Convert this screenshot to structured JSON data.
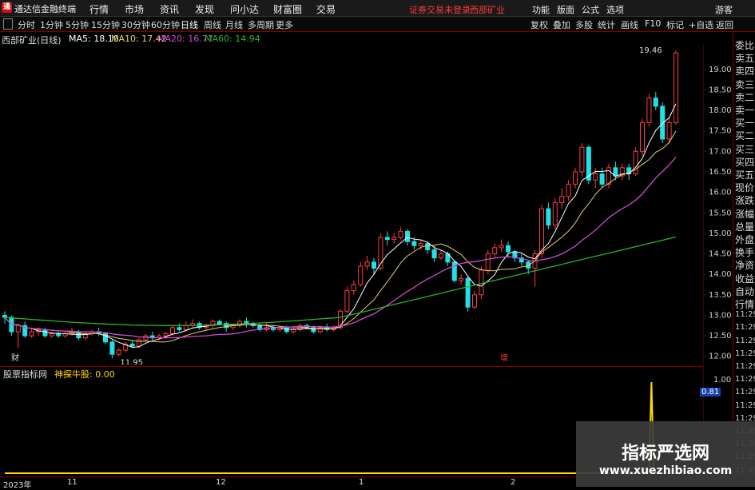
{
  "app": {
    "logo": "通",
    "title": "通达信金融终端"
  },
  "menu": [
    "行情",
    "市场",
    "资讯",
    "发现",
    "问小达",
    "财富圈",
    "交易"
  ],
  "login_status": "证券交易未登录",
  "stock_name_top": "西部矿业",
  "right_menu": [
    "功能",
    "版面",
    "公式",
    "选项",
    "游客"
  ],
  "periods": [
    "分时",
    "1分钟",
    "5分钟",
    "15分钟",
    "30分钟",
    "60分钟",
    "日线",
    "周线",
    "月线",
    "多周期",
    "更多"
  ],
  "active_period": "日线",
  "tools": [
    "复权",
    "叠加",
    "多股",
    "统计",
    "画线",
    "F10",
    "标记",
    "+自选",
    "返回"
  ],
  "ma": {
    "stock": "西部矿业(日线)",
    "ma5": "MA5: 18.10",
    "ma10": "MA10: 17.42",
    "ma20": "MA20: 16.77",
    "ma60": "MA60: 14.94"
  },
  "colors": {
    "up": "#ff3b3b",
    "down": "#21e0e6",
    "ma5": "#ffffff",
    "ma10": "#e6d06a",
    "ma20": "#d04bd0",
    "ma60": "#2ab42a"
  },
  "price_axis": [
    "19.00",
    "18.50",
    "18.00",
    "17.50",
    "17.00",
    "16.50",
    "16.00",
    "15.50",
    "15.00",
    "14.50",
    "14.00",
    "13.50",
    "13.00",
    "12.50",
    "12.00"
  ],
  "annotations": {
    "high": "19.46",
    "low": "11.95",
    "marker1": "财",
    "marker2": "增"
  },
  "indicator": {
    "name": "股票指标网",
    "formula": "神探牛股: 0.00",
    "axis_top": "1.00",
    "axis_mid": "0.81"
  },
  "right_panel": [
    "委比",
    "卖五",
    "卖四",
    "卖三",
    "卖二",
    "卖一",
    "买一",
    "买二",
    "买三",
    "买四",
    "买五",
    "现价",
    "涨跌",
    "涨幅",
    "总量",
    "外盘",
    "换手",
    "净资",
    "收益",
    "自动",
    "行情",
    "11:29",
    "11:29",
    "11:29",
    "11:29",
    "11:29",
    "11:29",
    "11:29",
    "11:29",
    "11:29",
    "11:29",
    "11:29",
    "11:29",
    "11:29"
  ],
  "dates": [
    "2023年",
    "11",
    "12",
    "1",
    "2"
  ],
  "watermark": {
    "title": "指标严选网",
    "url": "www.xuezhibiao.com"
  },
  "chart_data": {
    "type": "candlestick",
    "price_range": [
      11.8,
      19.6
    ],
    "candles": [
      [
        13.0,
        12.95,
        13.1,
        12.8
      ],
      [
        12.95,
        12.6,
        13.0,
        12.5
      ],
      [
        12.6,
        12.75,
        12.8,
        12.2
      ],
      [
        12.75,
        12.5,
        12.85,
        12.45
      ],
      [
        12.5,
        12.6,
        12.7,
        12.45
      ],
      [
        12.6,
        12.65,
        12.7,
        12.5
      ],
      [
        12.65,
        12.5,
        12.7,
        12.45
      ],
      [
        12.5,
        12.55,
        12.6,
        12.45
      ],
      [
        12.55,
        12.5,
        12.6,
        12.45
      ],
      [
        12.5,
        12.55,
        12.6,
        12.45
      ],
      [
        12.55,
        12.6,
        12.7,
        12.5
      ],
      [
        12.6,
        12.45,
        12.65,
        12.4
      ],
      [
        12.45,
        12.55,
        12.6,
        12.4
      ],
      [
        12.55,
        12.6,
        12.65,
        12.5
      ],
      [
        12.6,
        12.55,
        12.7,
        12.5
      ],
      [
        12.55,
        12.35,
        12.6,
        12.3
      ],
      [
        12.35,
        12.05,
        12.4,
        11.95
      ],
      [
        12.05,
        12.15,
        12.2,
        12.0
      ],
      [
        12.15,
        12.3,
        12.35,
        12.1
      ],
      [
        12.3,
        12.25,
        12.4,
        12.2
      ],
      [
        12.25,
        12.4,
        12.45,
        12.2
      ],
      [
        12.4,
        12.5,
        12.55,
        12.35
      ],
      [
        12.5,
        12.45,
        12.6,
        12.4
      ],
      [
        12.45,
        12.5,
        12.55,
        12.4
      ],
      [
        12.5,
        12.55,
        12.6,
        12.45
      ],
      [
        12.55,
        12.7,
        12.75,
        12.5
      ],
      [
        12.7,
        12.65,
        12.8,
        12.6
      ],
      [
        12.65,
        12.75,
        12.85,
        12.6
      ],
      [
        12.75,
        12.8,
        12.9,
        12.7
      ],
      [
        12.8,
        12.7,
        12.85,
        12.65
      ],
      [
        12.7,
        12.75,
        12.8,
        12.65
      ],
      [
        12.75,
        12.85,
        12.9,
        12.7
      ],
      [
        12.85,
        12.8,
        12.9,
        12.75
      ],
      [
        12.8,
        12.7,
        12.85,
        12.6
      ],
      [
        12.7,
        12.75,
        12.8,
        12.65
      ],
      [
        12.75,
        12.85,
        12.9,
        12.7
      ],
      [
        12.85,
        12.8,
        12.95,
        12.7
      ],
      [
        12.8,
        12.75,
        12.85,
        12.7
      ],
      [
        12.75,
        12.65,
        12.8,
        12.6
      ],
      [
        12.65,
        12.7,
        12.8,
        12.6
      ],
      [
        12.7,
        12.65,
        12.75,
        12.6
      ],
      [
        12.65,
        12.7,
        12.75,
        12.6
      ],
      [
        12.7,
        12.6,
        12.75,
        12.55
      ],
      [
        12.6,
        12.65,
        12.7,
        12.55
      ],
      [
        12.65,
        12.75,
        12.8,
        12.6
      ],
      [
        12.75,
        12.7,
        12.8,
        12.65
      ],
      [
        12.7,
        12.6,
        12.75,
        12.55
      ],
      [
        12.6,
        12.7,
        12.75,
        12.55
      ],
      [
        12.7,
        12.65,
        12.8,
        12.6
      ],
      [
        12.65,
        12.7,
        12.75,
        12.6
      ],
      [
        12.7,
        13.1,
        13.15,
        12.65
      ],
      [
        13.1,
        13.6,
        13.7,
        13.05
      ],
      [
        13.6,
        13.75,
        13.85,
        13.5
      ],
      [
        13.75,
        14.2,
        14.3,
        13.7
      ],
      [
        14.2,
        14.3,
        14.45,
        14.1
      ],
      [
        14.3,
        14.15,
        14.4,
        14.0
      ],
      [
        14.15,
        14.9,
        15.0,
        14.1
      ],
      [
        14.9,
        14.85,
        15.05,
        14.7
      ],
      [
        14.85,
        14.9,
        15.0,
        14.75
      ],
      [
        14.9,
        15.05,
        15.15,
        14.85
      ],
      [
        15.05,
        14.8,
        15.1,
        14.7
      ],
      [
        14.8,
        14.7,
        14.9,
        14.6
      ],
      [
        14.7,
        14.75,
        14.85,
        14.6
      ],
      [
        14.75,
        14.6,
        14.8,
        14.5
      ],
      [
        14.6,
        14.4,
        14.7,
        14.3
      ],
      [
        14.4,
        14.5,
        14.6,
        14.35
      ],
      [
        14.5,
        14.3,
        14.55,
        14.2
      ],
      [
        14.3,
        13.85,
        14.35,
        13.8
      ],
      [
        13.85,
        13.9,
        14.0,
        13.75
      ],
      [
        13.9,
        13.2,
        13.95,
        13.1
      ],
      [
        13.2,
        13.5,
        13.6,
        13.15
      ],
      [
        13.5,
        14.1,
        14.2,
        13.4
      ],
      [
        14.1,
        14.5,
        14.6,
        14.0
      ],
      [
        14.5,
        14.65,
        14.75,
        14.4
      ],
      [
        14.65,
        14.7,
        14.85,
        14.55
      ],
      [
        14.7,
        14.55,
        14.8,
        14.4
      ],
      [
        14.55,
        14.4,
        14.6,
        14.3
      ],
      [
        14.4,
        14.3,
        14.5,
        14.2
      ],
      [
        14.3,
        14.15,
        14.35,
        14.0
      ],
      [
        14.15,
        14.5,
        14.6,
        13.7
      ],
      [
        14.5,
        15.6,
        15.7,
        14.4
      ],
      [
        15.6,
        15.2,
        15.75,
        15.1
      ],
      [
        15.2,
        15.75,
        15.85,
        15.1
      ],
      [
        15.75,
        15.9,
        16.1,
        15.6
      ],
      [
        15.9,
        16.2,
        16.3,
        15.8
      ],
      [
        16.2,
        16.5,
        16.6,
        16.1
      ],
      [
        16.5,
        17.1,
        17.2,
        16.4
      ],
      [
        17.1,
        16.3,
        17.15,
        16.2
      ],
      [
        16.3,
        16.45,
        16.6,
        16.1
      ],
      [
        16.45,
        16.2,
        16.6,
        16.1
      ],
      [
        16.2,
        16.6,
        16.7,
        16.1
      ],
      [
        16.6,
        16.4,
        16.75,
        16.3
      ],
      [
        16.4,
        16.6,
        16.7,
        16.3
      ],
      [
        16.6,
        16.45,
        16.7,
        16.3
      ],
      [
        16.45,
        17.0,
        17.1,
        16.4
      ],
      [
        17.0,
        17.7,
        17.8,
        16.9
      ],
      [
        17.7,
        18.3,
        18.4,
        17.6
      ],
      [
        18.3,
        18.1,
        18.45,
        18.0
      ],
      [
        18.1,
        17.3,
        18.2,
        17.2
      ],
      [
        17.3,
        17.7,
        17.8,
        17.2
      ],
      [
        17.7,
        19.4,
        19.46,
        17.65
      ]
    ],
    "indicator_values": "0 throughout, spike to 1.00 near end"
  }
}
